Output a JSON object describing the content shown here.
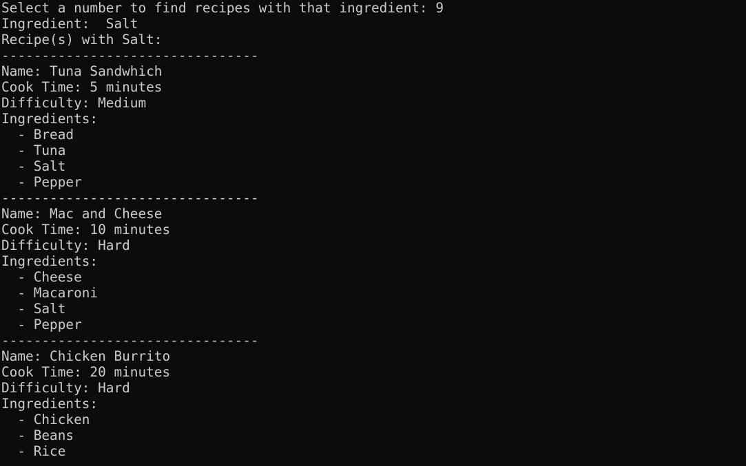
{
  "terminal": {
    "lines": [
      "Select a number to find recipes with that ingredient: 9",
      "Ingredient:  Salt",
      "Recipe(s) with Salt:",
      "--------------------------------",
      "Name: Tuna Sandwhich",
      "Cook Time: 5 minutes",
      "Difficulty: Medium",
      "Ingredients:",
      "  - Bread",
      "  - Tuna",
      "  - Salt",
      "  - Pepper",
      "--------------------------------",
      "Name: Mac and Cheese",
      "Cook Time: 10 minutes",
      "Difficulty: Hard",
      "Ingredients:",
      "  - Cheese",
      "  - Macaroni",
      "  - Salt",
      "  - Pepper",
      "--------------------------------",
      "Name: Chicken Burrito",
      "Cook Time: 20 minutes",
      "Difficulty: Hard",
      "Ingredients:",
      "  - Chicken",
      "  - Beans",
      "  - Rice"
    ]
  }
}
